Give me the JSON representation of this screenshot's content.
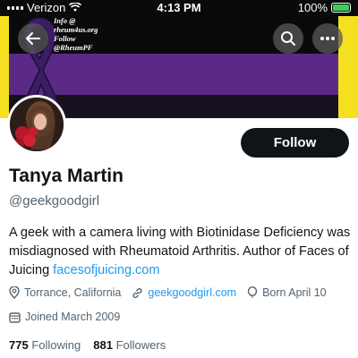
{
  "status_bar": {
    "carrier": "Verizon",
    "time": "4:13 PM",
    "battery": "100%"
  },
  "banner": {
    "info_lines": [
      "Info @",
      "rheum4us.org",
      "Follow",
      "@RheumPF"
    ],
    "colors": {
      "yellow": "#f5e020",
      "purple": "#5b2a86",
      "dark": "#0a0a0a"
    }
  },
  "nav": {
    "back_icon": "arrow-left-icon",
    "search_icon": "search-icon",
    "more_icon": "more-horizontal-icon"
  },
  "profile": {
    "follow_label": "Follow",
    "display_name": "Tanya Martin",
    "handle": "@geekgoodgirl",
    "bio_text": "A geek with a camera living with Biotinidase Deficiency was misdiagnosed with Rheumatoid Arthritis. Author of Faces of Juicing ",
    "bio_link": "facesofjuicing.com",
    "location": "Torrance, California",
    "website": "geekgoodgirl.com",
    "birthday": "Born April 10",
    "joined": "Joined March 2009",
    "following_count": "775",
    "following_label": "Following",
    "followers_count": "881",
    "followers_label": "Followers"
  },
  "colors": {
    "accent": "#1d9bf0",
    "text": "#0f1419",
    "muted": "#536471"
  }
}
